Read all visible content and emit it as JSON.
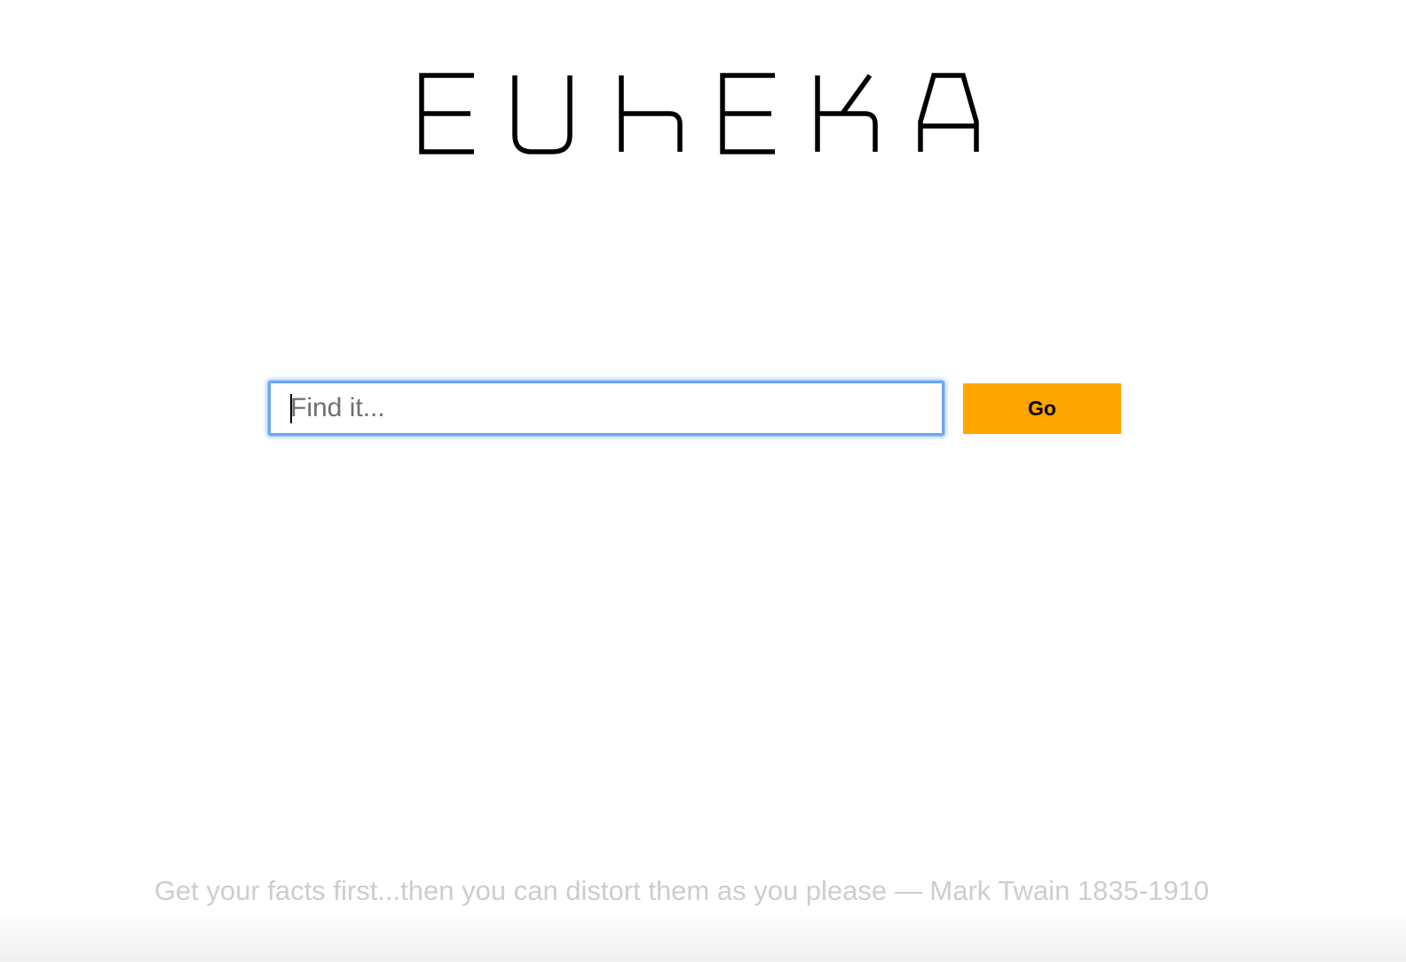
{
  "logo": {
    "text": "EUREKA"
  },
  "search": {
    "value": "",
    "placeholder": "Find it...",
    "go_label": "Go"
  },
  "footer": {
    "quote": "Get your facts first...then you can distort them as you please — Mark Twain 1835-1910"
  },
  "colors": {
    "go_button": "#ffa500",
    "input_focus_border": "#6aa7ee",
    "quote_text": "#cdcdcd"
  }
}
